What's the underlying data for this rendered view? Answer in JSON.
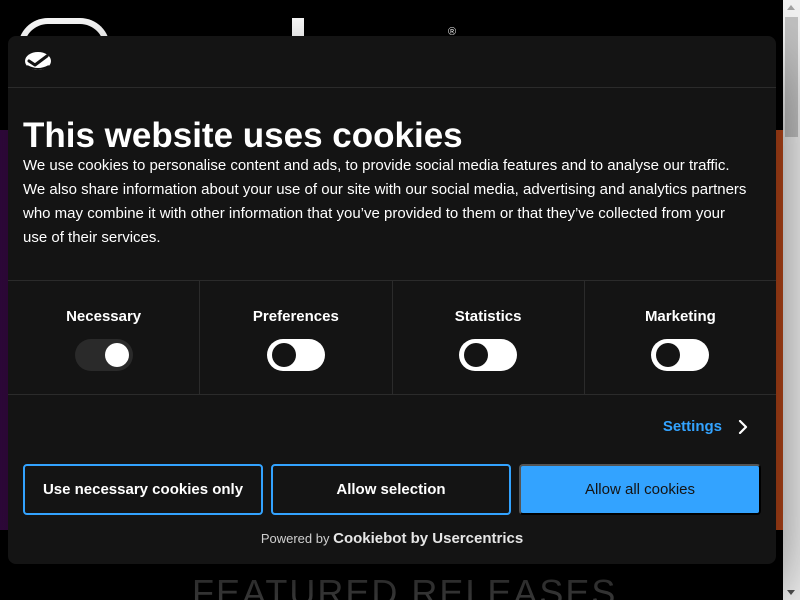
{
  "dialog": {
    "title": "This website uses cookies",
    "body": "We use cookies to personalise content and ads, to provide social media features and to analyse our traffic. We also share information about your use of our site with our social media, advertising and analytics partners who may combine it with other information that you’ve provided to them or that they’ve collected from your use of their services.",
    "categories": [
      {
        "label": "Necessary",
        "state": "on-disabled"
      },
      {
        "label": "Preferences",
        "state": "off"
      },
      {
        "label": "Statistics",
        "state": "off"
      },
      {
        "label": "Marketing",
        "state": "off"
      }
    ],
    "settings_label": "Settings",
    "buttons": {
      "necessary_only": "Use necessary cookies only",
      "allow_selection": "Allow selection",
      "allow_all": "Allow all cookies"
    },
    "powered_by_prefix": "Powered by",
    "powered_by_brand": "Cookiebot by Usercentrics"
  },
  "site": {
    "logo_reg_mark": "®",
    "featured_heading": "FEATURED RELEASES"
  },
  "colors": {
    "accent": "#33a3ff",
    "dialog_bg": "#141414"
  }
}
